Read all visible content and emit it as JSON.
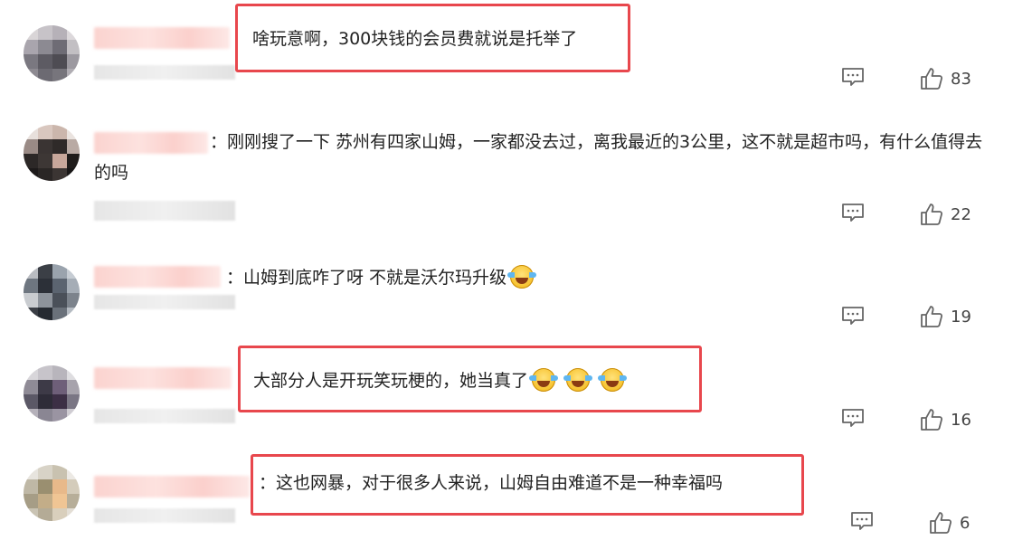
{
  "comments": [
    {
      "text": "啥玩意啊，300块钱的会员费就说是托举了",
      "like_count": "83",
      "highlighted": true,
      "reply_icon": "comment-bubble-icon",
      "like_icon": "thumbs-up-icon"
    },
    {
      "text": "：刚刚搜了一下 苏州有四家山姆，一家都没去过，离我最近的3公里，这不就是超市吗，有什么值得去的吗",
      "like_count": "22",
      "highlighted": false,
      "reply_icon": "comment-bubble-icon",
      "like_icon": "thumbs-up-icon"
    },
    {
      "text": "：山姆到底咋了呀 不就是沃尔玛升级",
      "emoji_count": 1,
      "emoji_icon": "laughing-crying-emoji",
      "like_count": "19",
      "highlighted": false,
      "reply_icon": "comment-bubble-icon",
      "like_icon": "thumbs-up-icon"
    },
    {
      "text": "大部分人是开玩笑玩梗的，她当真了",
      "emoji_count": 3,
      "emoji_icon": "laughing-crying-emoji",
      "like_count": "16",
      "highlighted": true,
      "reply_icon": "comment-bubble-icon",
      "like_icon": "thumbs-up-icon"
    },
    {
      "text": "：这也网暴，对于很多人来说，山姆自由难道不是一种幸福吗",
      "like_count": "6",
      "highlighted": true,
      "reply_icon": "comment-bubble-icon",
      "like_icon": "thumbs-up-icon"
    }
  ],
  "colors": {
    "highlight_border": "#e8474d",
    "text": "#222222",
    "icon": "#666666"
  }
}
